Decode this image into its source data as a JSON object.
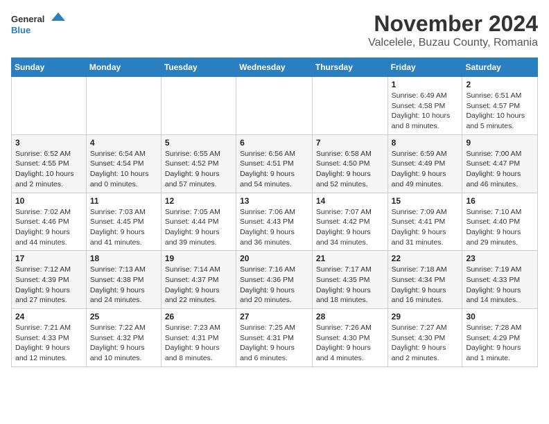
{
  "header": {
    "logo_general": "General",
    "logo_blue": "Blue",
    "month_title": "November 2024",
    "location": "Valcelele, Buzau County, Romania"
  },
  "days_of_week": [
    "Sunday",
    "Monday",
    "Tuesday",
    "Wednesday",
    "Thursday",
    "Friday",
    "Saturday"
  ],
  "weeks": [
    [
      {
        "day": "",
        "info": ""
      },
      {
        "day": "",
        "info": ""
      },
      {
        "day": "",
        "info": ""
      },
      {
        "day": "",
        "info": ""
      },
      {
        "day": "",
        "info": ""
      },
      {
        "day": "1",
        "info": "Sunrise: 6:49 AM\nSunset: 4:58 PM\nDaylight: 10 hours and 8 minutes."
      },
      {
        "day": "2",
        "info": "Sunrise: 6:51 AM\nSunset: 4:57 PM\nDaylight: 10 hours and 5 minutes."
      }
    ],
    [
      {
        "day": "3",
        "info": "Sunrise: 6:52 AM\nSunset: 4:55 PM\nDaylight: 10 hours and 2 minutes."
      },
      {
        "day": "4",
        "info": "Sunrise: 6:54 AM\nSunset: 4:54 PM\nDaylight: 10 hours and 0 minutes."
      },
      {
        "day": "5",
        "info": "Sunrise: 6:55 AM\nSunset: 4:52 PM\nDaylight: 9 hours and 57 minutes."
      },
      {
        "day": "6",
        "info": "Sunrise: 6:56 AM\nSunset: 4:51 PM\nDaylight: 9 hours and 54 minutes."
      },
      {
        "day": "7",
        "info": "Sunrise: 6:58 AM\nSunset: 4:50 PM\nDaylight: 9 hours and 52 minutes."
      },
      {
        "day": "8",
        "info": "Sunrise: 6:59 AM\nSunset: 4:49 PM\nDaylight: 9 hours and 49 minutes."
      },
      {
        "day": "9",
        "info": "Sunrise: 7:00 AM\nSunset: 4:47 PM\nDaylight: 9 hours and 46 minutes."
      }
    ],
    [
      {
        "day": "10",
        "info": "Sunrise: 7:02 AM\nSunset: 4:46 PM\nDaylight: 9 hours and 44 minutes."
      },
      {
        "day": "11",
        "info": "Sunrise: 7:03 AM\nSunset: 4:45 PM\nDaylight: 9 hours and 41 minutes."
      },
      {
        "day": "12",
        "info": "Sunrise: 7:05 AM\nSunset: 4:44 PM\nDaylight: 9 hours and 39 minutes."
      },
      {
        "day": "13",
        "info": "Sunrise: 7:06 AM\nSunset: 4:43 PM\nDaylight: 9 hours and 36 minutes."
      },
      {
        "day": "14",
        "info": "Sunrise: 7:07 AM\nSunset: 4:42 PM\nDaylight: 9 hours and 34 minutes."
      },
      {
        "day": "15",
        "info": "Sunrise: 7:09 AM\nSunset: 4:41 PM\nDaylight: 9 hours and 31 minutes."
      },
      {
        "day": "16",
        "info": "Sunrise: 7:10 AM\nSunset: 4:40 PM\nDaylight: 9 hours and 29 minutes."
      }
    ],
    [
      {
        "day": "17",
        "info": "Sunrise: 7:12 AM\nSunset: 4:39 PM\nDaylight: 9 hours and 27 minutes."
      },
      {
        "day": "18",
        "info": "Sunrise: 7:13 AM\nSunset: 4:38 PM\nDaylight: 9 hours and 24 minutes."
      },
      {
        "day": "19",
        "info": "Sunrise: 7:14 AM\nSunset: 4:37 PM\nDaylight: 9 hours and 22 minutes."
      },
      {
        "day": "20",
        "info": "Sunrise: 7:16 AM\nSunset: 4:36 PM\nDaylight: 9 hours and 20 minutes."
      },
      {
        "day": "21",
        "info": "Sunrise: 7:17 AM\nSunset: 4:35 PM\nDaylight: 9 hours and 18 minutes."
      },
      {
        "day": "22",
        "info": "Sunrise: 7:18 AM\nSunset: 4:34 PM\nDaylight: 9 hours and 16 minutes."
      },
      {
        "day": "23",
        "info": "Sunrise: 7:19 AM\nSunset: 4:33 PM\nDaylight: 9 hours and 14 minutes."
      }
    ],
    [
      {
        "day": "24",
        "info": "Sunrise: 7:21 AM\nSunset: 4:33 PM\nDaylight: 9 hours and 12 minutes."
      },
      {
        "day": "25",
        "info": "Sunrise: 7:22 AM\nSunset: 4:32 PM\nDaylight: 9 hours and 10 minutes."
      },
      {
        "day": "26",
        "info": "Sunrise: 7:23 AM\nSunset: 4:31 PM\nDaylight: 9 hours and 8 minutes."
      },
      {
        "day": "27",
        "info": "Sunrise: 7:25 AM\nSunset: 4:31 PM\nDaylight: 9 hours and 6 minutes."
      },
      {
        "day": "28",
        "info": "Sunrise: 7:26 AM\nSunset: 4:30 PM\nDaylight: 9 hours and 4 minutes."
      },
      {
        "day": "29",
        "info": "Sunrise: 7:27 AM\nSunset: 4:30 PM\nDaylight: 9 hours and 2 minutes."
      },
      {
        "day": "30",
        "info": "Sunrise: 7:28 AM\nSunset: 4:29 PM\nDaylight: 9 hours and 1 minute."
      }
    ]
  ]
}
